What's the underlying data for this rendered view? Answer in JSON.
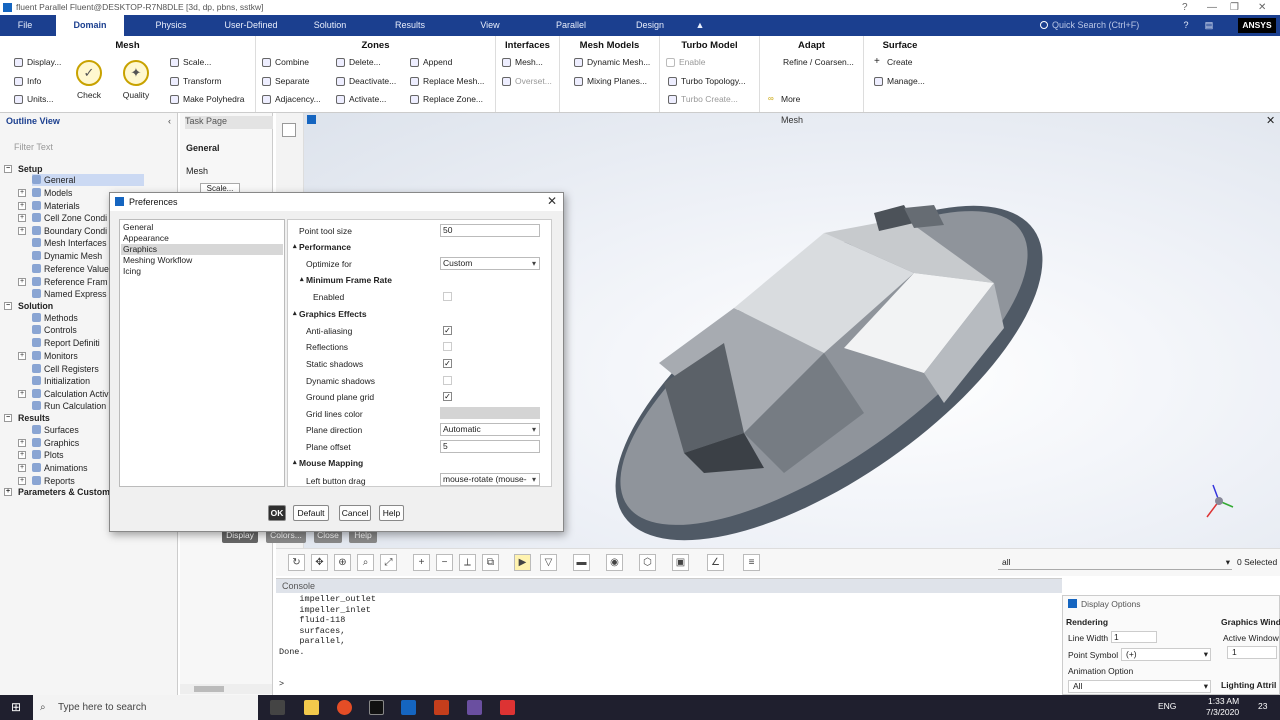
{
  "window": {
    "title": "fluent Parallel Fluent@DESKTOP-R7N8DLE [3d, dp, pbns, sstkw]"
  },
  "menu": {
    "items": [
      "File",
      "Domain",
      "Physics",
      "User-Defined",
      "Solution",
      "Results",
      "View",
      "Parallel",
      "Design"
    ],
    "active": "Domain",
    "search_placeholder": "Quick Search (Ctrl+F)",
    "brand": "ANSYS"
  },
  "ribbon": {
    "mesh": {
      "title": "Mesh",
      "display": "Display...",
      "info": "Info",
      "units": "Units...",
      "check": "Check",
      "quality": "Quality",
      "scale": "Scale...",
      "transform": "Transform",
      "polyhedra": "Make Polyhedra"
    },
    "zones": {
      "title": "Zones",
      "combine": "Combine",
      "delete": "Delete...",
      "append": "Append",
      "separate": "Separate",
      "deactivate": "Deactivate...",
      "replace_mesh": "Replace Mesh...",
      "adjacency": "Adjacency...",
      "activate": "Activate...",
      "replace_zone": "Replace Zone..."
    },
    "interfaces": {
      "title": "Interfaces",
      "mesh": "Mesh...",
      "overset": "Overset..."
    },
    "mesh_models": {
      "title": "Mesh Models",
      "dynamic": "Dynamic Mesh...",
      "mixing": "Mixing Planes..."
    },
    "turbo": {
      "title": "Turbo Model",
      "enable": "Enable",
      "topology": "Turbo Topology...",
      "create": "Turbo Create..."
    },
    "adapt": {
      "title": "Adapt",
      "refine": "Refine / Coarsen...",
      "more": "More"
    },
    "surface": {
      "title": "Surface",
      "create": "Create",
      "manage": "Manage..."
    }
  },
  "outline": {
    "title": "Outline View",
    "filter_placeholder": "Filter Text",
    "setup": "Setup",
    "setup_items": [
      "General",
      "Models",
      "Materials",
      "Cell Zone Condi",
      "Boundary Condi",
      "Mesh Interfaces",
      "Dynamic Mesh",
      "Reference Value",
      "Reference Fram",
      "Named Express"
    ],
    "solution": "Solution",
    "solution_items": [
      "Methods",
      "Controls",
      "Report Definiti",
      "Monitors",
      "Cell Registers",
      "Initialization",
      "Calculation Activ",
      "Run Calculation"
    ],
    "results": "Results",
    "results_items": [
      "Surfaces",
      "Graphics",
      "Plots",
      "Animations",
      "Reports"
    ],
    "params": "Parameters & Custom"
  },
  "taskpage": {
    "title": "Task Page",
    "heading": "General",
    "mesh_label": "Mesh",
    "scale_btn": "Scale..."
  },
  "viewport": {
    "title": "Mesh"
  },
  "toolbar": {
    "selection_filter": "all",
    "selected_count": "0 Selected"
  },
  "console": {
    "title": "Console",
    "lines": [
      "    impeller_outlet",
      "    impeller_inlet",
      "    fluid-118",
      "    surfaces,",
      "    parallel,",
      "Done.",
      "",
      "",
      "> "
    ]
  },
  "display_options": {
    "title": "Display Options",
    "rendering": "Rendering",
    "line_width_label": "Line Width",
    "line_width": "1",
    "point_symbol_label": "Point Symbol",
    "point_symbol": "(+)",
    "animation_label": "Animation Option",
    "animation": "All",
    "graphics_window": "Graphics Wind",
    "active_window_label": "Active Window",
    "active_window": "1",
    "lighting": "Lighting Attril"
  },
  "lower_buttons": {
    "display": "Display",
    "colors": "Colors...",
    "close": "Close",
    "help": "Help"
  },
  "preferences": {
    "title": "Preferences",
    "categories": [
      "General",
      "Appearance",
      "Graphics",
      "Meshing Workflow",
      "Icing"
    ],
    "selected_category": "Graphics",
    "point_tool_size_label": "Point tool size",
    "point_tool_size": "50",
    "performance": "Performance",
    "optimize_for_label": "Optimize for",
    "optimize_for": "Custom",
    "min_frame_rate": "Minimum Frame Rate",
    "enabled_label": "Enabled",
    "graphics_effects": "Graphics Effects",
    "anti_aliasing": "Anti-aliasing",
    "reflections": "Reflections",
    "static_shadows": "Static shadows",
    "dynamic_shadows": "Dynamic shadows",
    "ground_plane_grid": "Ground plane grid",
    "grid_lines_color": "Grid lines color",
    "plane_direction_label": "Plane direction",
    "plane_direction": "Automatic",
    "plane_offset_label": "Plane offset",
    "plane_offset": "5",
    "mouse_mapping": "Mouse Mapping",
    "left_button_drag_label": "Left button drag",
    "left_button_drag": "mouse-rotate (mouse-",
    "checks": {
      "enabled": false,
      "anti_aliasing": true,
      "reflections": false,
      "static_shadows": true,
      "dynamic_shadows": false,
      "ground_plane_grid": true
    },
    "buttons": {
      "ok": "OK",
      "default": "Default",
      "cancel": "Cancel",
      "help": "Help"
    }
  },
  "taskbar": {
    "search_placeholder": "Type here to search",
    "time": "1:33 AM",
    "date": "7/3/2020",
    "lang": "ENG",
    "notif": "23"
  }
}
